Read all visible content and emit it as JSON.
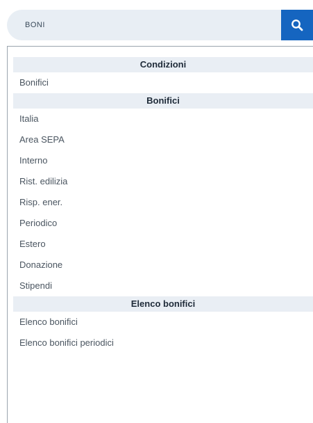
{
  "search": {
    "value": "BONI",
    "icon": "search-icon",
    "button_color": "#1565c0"
  },
  "groups": [
    {
      "header": "Condizioni",
      "items": [
        "Bonifici"
      ]
    },
    {
      "header": "Bonifici",
      "items": [
        "Italia",
        "Area SEPA",
        "Interno",
        "Rist. edilizia",
        "Risp. ener.",
        "Periodico",
        "Estero",
        "Donazione",
        "Stipendi"
      ]
    },
    {
      "header": "Elenco bonifici",
      "items": [
        "Elenco bonifici",
        "Elenco bonifici periodici"
      ]
    }
  ]
}
